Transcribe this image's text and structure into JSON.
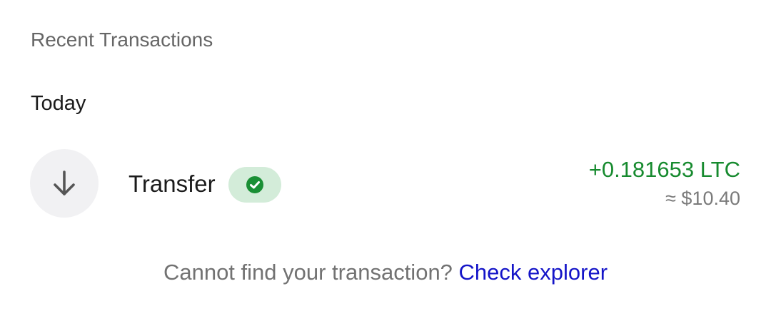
{
  "section": {
    "title": "Recent Transactions"
  },
  "groups": [
    {
      "title": "Today",
      "transactions": [
        {
          "icon": "arrow-down-icon",
          "label": "Transfer",
          "status_icon": "check-circle-icon",
          "amount": "+0.181653 LTC",
          "fiat": "≈ $10.40"
        }
      ]
    }
  ],
  "footer": {
    "text": "Cannot find your transaction?",
    "link_label": "Check explorer"
  },
  "colors": {
    "amount_positive": "#168a2e",
    "status_bg": "#d3ecd9",
    "status_icon": "#1a8f35",
    "link": "#1414c8",
    "icon_bg": "#f1f1f3"
  }
}
